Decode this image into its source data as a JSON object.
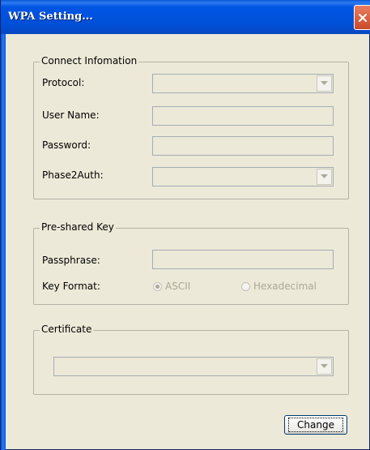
{
  "window": {
    "title": "WPA Setting..."
  },
  "connect": {
    "legend": "Connect Infomation",
    "protocol_label": "Protocol:",
    "username_label": "User Name:",
    "password_label": "Password:",
    "phase2_label": "Phase2Auth:"
  },
  "psk": {
    "legend": "Pre-shared Key",
    "passphrase_label": "Passphrase:",
    "keyformat_label": "Key Format:",
    "ascii_label": "ASCII",
    "hex_label": "Hexadecimal",
    "selected": "ASCII"
  },
  "certificate": {
    "legend": "Certificate"
  },
  "buttons": {
    "change": "Change"
  },
  "icons": {
    "close": "close-icon",
    "dropdown": "chevron-down-icon"
  }
}
